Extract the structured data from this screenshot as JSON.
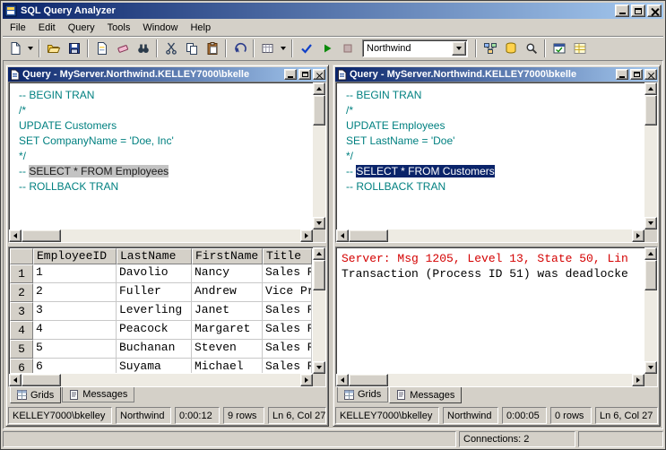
{
  "app": {
    "title": "SQL Query Analyzer"
  },
  "menu": {
    "items": [
      "File",
      "Edit",
      "Query",
      "Tools",
      "Window",
      "Help"
    ]
  },
  "toolbar": {
    "database": "Northwind",
    "icons": [
      "new-query-icon",
      "template-dropdown-icon",
      "open-file-icon",
      "save-icon",
      "insert-template-icon",
      "clear-window-icon",
      "find-icon",
      "cut-icon",
      "copy-icon",
      "paste-icon",
      "undo-icon",
      "execute-mode-icon",
      "parse-query-icon",
      "execute-query-icon",
      "cancel-query-icon",
      "database-combo",
      "display-plan-icon",
      "object-browser-icon",
      "object-search-icon",
      "connection-properties-icon",
      "show-results-pane-icon"
    ]
  },
  "colors": {
    "title_gradient_start": "#0a246a",
    "title_gradient_end": "#a6caf0",
    "comment_text": "#008080",
    "error_text": "#d40000",
    "selection_bg": "#0a246a",
    "window_gray": "#d4d0c8"
  },
  "left": {
    "title": "Query - MyServer.Northwind.KELLEY7000\\bkelle",
    "editor": {
      "l1": "-- BEGIN TRAN",
      "l2": "/*",
      "l3": "UPDATE Customers",
      "l4": "SET CompanyName = 'Doe, Inc'",
      "l5": "*/",
      "l6p": "-- ",
      "l6s": "SELECT * FROM Employees",
      "l7": "-- ROLLBACK TRAN"
    },
    "grid": {
      "h": [
        "",
        "EmployeeID",
        "LastName",
        "FirstName",
        "Title"
      ],
      "r1": [
        "1",
        "1",
        "Davolio",
        "Nancy",
        "Sales R"
      ],
      "r2": [
        "2",
        "2",
        "Fuller",
        "Andrew",
        "Vice Pr"
      ],
      "r3": [
        "3",
        "3",
        "Leverling",
        "Janet",
        "Sales R"
      ],
      "r4": [
        "4",
        "4",
        "Peacock",
        "Margaret",
        "Sales R"
      ],
      "r5": [
        "5",
        "5",
        "Buchanan",
        "Steven",
        "Sales R"
      ],
      "r6": [
        "6",
        "6",
        "Suyama",
        "Michael",
        "Sales R"
      ]
    },
    "tabs": {
      "grids": "Grids",
      "messages": "Messages"
    },
    "status": [
      "KELLEY7000\\bkelley",
      "Northwind",
      "0:00:12",
      "9 rows",
      "Ln 6, Col 27"
    ]
  },
  "right": {
    "title": "Query - MyServer.Northwind.KELLEY7000\\bkelle",
    "editor": {
      "l1": "-- BEGIN TRAN",
      "l2": "/*",
      "l3": "UPDATE Employees",
      "l4": "SET LastName = 'Doe'",
      "l5": "*/",
      "l6p": "-- ",
      "l6s": "SELECT * FROM Customers",
      "l7": "-- ROLLBACK TRAN"
    },
    "messages": {
      "error": "Server: Msg 1205, Level 13, State 50, Lin",
      "detail": "Transaction (Process ID 51) was deadlocke"
    },
    "tabs": {
      "grids": "Grids",
      "messages": "Messages"
    },
    "status": [
      "KELLEY7000\\bkelley",
      "Northwind",
      "0:00:05",
      "0 rows",
      "Ln 6, Col 27"
    ]
  },
  "statusbar": {
    "connections": "Connections: 2"
  }
}
